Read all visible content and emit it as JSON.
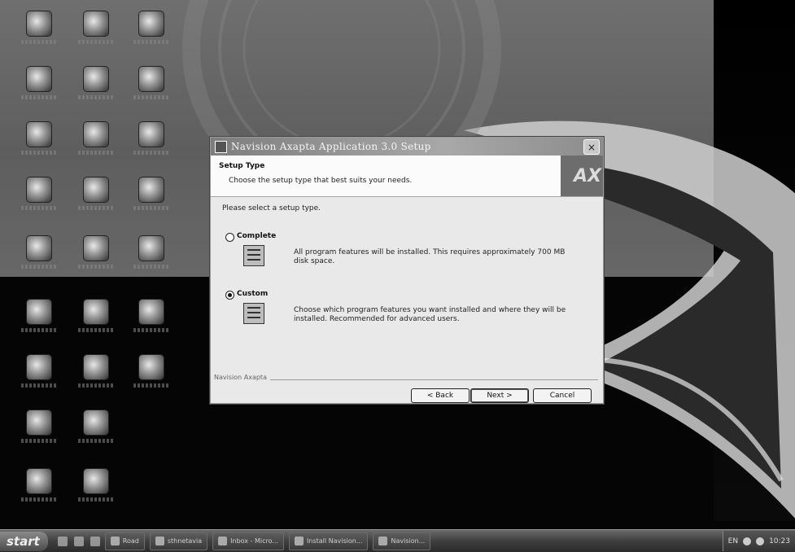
{
  "window": {
    "title": "Navision Axapta Application 3.0 Setup",
    "close_glyph": "×",
    "app_icon": "setup-app-icon"
  },
  "header": {
    "title": "Setup Type",
    "subtitle": "Choose the setup type that best suits your needs.",
    "logo": "AX"
  },
  "prompt": "Please select a setup type.",
  "options": [
    {
      "label": "Complete",
      "description": "All program features will be installed. This requires approximately 700 MB disk space.",
      "selected": false,
      "icon": "complete-setup-icon"
    },
    {
      "label": "Custom",
      "description": "Choose which program features you want installed and where they will be installed. Recommended for advanced users.",
      "selected": true,
      "icon": "custom-setup-icon"
    }
  ],
  "footer": {
    "brand": "Navision Axapta",
    "back": "< Back",
    "next": "Next >",
    "cancel": "Cancel"
  },
  "taskbar": {
    "start": "start",
    "tasks": [
      "Road",
      "sthnetavia",
      "Inbox - Micro...",
      "Install Navision...",
      "Navision..."
    ],
    "language": "EN",
    "clock": "10:23"
  },
  "colors": {
    "desktop_wash": "#6f6f6f",
    "desktop_dark": "#050505",
    "dialog_face": "#e9e9e9",
    "titlebar": "#8c8c8c"
  }
}
